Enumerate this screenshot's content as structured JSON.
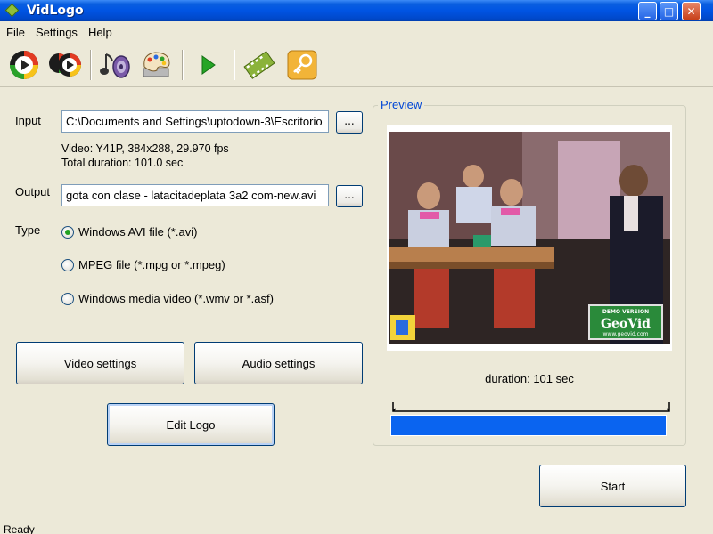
{
  "window": {
    "title": "VidLogo",
    "minimize_label": "_",
    "maximize_label": "□",
    "close_label": "✕"
  },
  "menu": {
    "items": [
      "File",
      "Settings",
      "Help"
    ]
  },
  "toolbar": {
    "buttons": [
      {
        "icon": "play-disc-icon"
      },
      {
        "icon": "play-disc-batch-icon"
      },
      {
        "icon": "audio-speaker-icon"
      },
      {
        "icon": "palette-icon"
      },
      {
        "icon": "play-arrow-icon"
      },
      {
        "icon": "film-strip-icon"
      },
      {
        "icon": "key-icon"
      }
    ]
  },
  "input": {
    "label": "Input",
    "value": "C:\\Documents and Settings\\uptodown-3\\Escritorio",
    "browse_label": "...",
    "info_line1": "Video: Y41P, 384x288, 29.970 fps",
    "info_line2": "Total duration: 101.0 sec"
  },
  "output": {
    "label": "Output",
    "value": "gota con clase - latacitadeplata 3a2 com-new.avi",
    "browse_label": "..."
  },
  "type": {
    "label": "Type",
    "options": [
      {
        "label": "Windows AVI file (*.avi)",
        "checked": true
      },
      {
        "label": "MPEG file (*.mpg or *.mpeg)",
        "checked": false
      },
      {
        "label": "Windows media video (*.wmv or *.asf)",
        "checked": false
      }
    ]
  },
  "buttons": {
    "video_settings": "Video settings",
    "audio_settings": "Audio settings",
    "edit_logo": "Edit Logo",
    "start": "Start"
  },
  "preview": {
    "title": "Preview",
    "duration_text": "duration: 101 sec",
    "progress_fraction": 1.0,
    "watermark_line1": "DEMO VERSION",
    "watermark_line2": "GeoVid",
    "watermark_line3": "www.geovid.com"
  },
  "status": {
    "text": "Ready"
  },
  "colors": {
    "titlebar": "#0054e3",
    "face": "#ece9d8",
    "accent_blue": "#0a64f0",
    "group_title": "#0046d5"
  }
}
